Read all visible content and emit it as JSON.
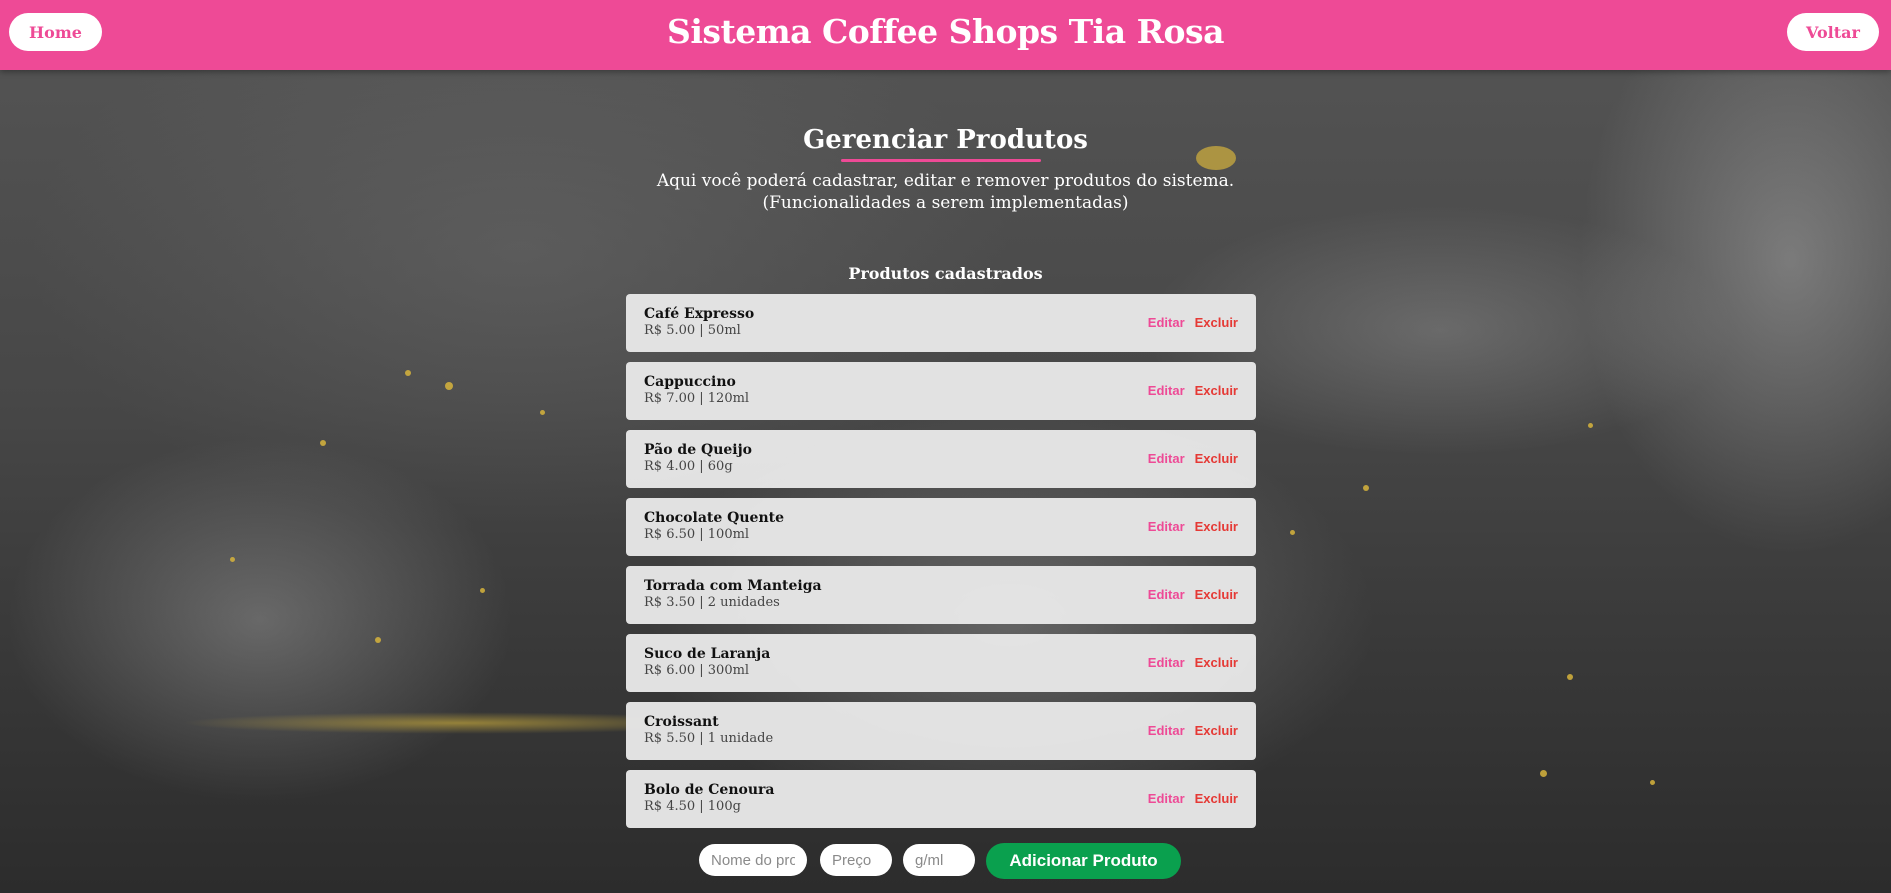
{
  "header": {
    "title": "Sistema Coffee Shops Tia Rosa",
    "home_label": "Home",
    "back_label": "Voltar"
  },
  "page": {
    "title": "Gerenciar Produtos",
    "description_line1": "Aqui você poderá cadastrar, editar e remover produtos do sistema.",
    "description_line2": "(Funcionalidades a serem implementadas)",
    "list_title": "Produtos cadastrados"
  },
  "products": [
    {
      "name": "Café Expresso",
      "meta": "R$ 5.00 | 50ml",
      "edit": "Editar",
      "delete": "Excluir"
    },
    {
      "name": "Cappuccino",
      "meta": "R$ 7.00 | 120ml",
      "edit": "Editar",
      "delete": "Excluir"
    },
    {
      "name": "Pão de Queijo",
      "meta": "R$ 4.00 | 60g",
      "edit": "Editar",
      "delete": "Excluir"
    },
    {
      "name": "Chocolate Quente",
      "meta": "R$ 6.50 | 100ml",
      "edit": "Editar",
      "delete": "Excluir"
    },
    {
      "name": "Torrada com Manteiga",
      "meta": "R$ 3.50 | 2 unidades",
      "edit": "Editar",
      "delete": "Excluir"
    },
    {
      "name": "Suco de Laranja",
      "meta": "R$ 6.00 | 300ml",
      "edit": "Editar",
      "delete": "Excluir"
    },
    {
      "name": "Croissant",
      "meta": "R$ 5.50 | 1 unidade",
      "edit": "Editar",
      "delete": "Excluir"
    },
    {
      "name": "Bolo de Cenoura",
      "meta": "R$ 4.50 | 100g",
      "edit": "Editar",
      "delete": "Excluir"
    }
  ],
  "form": {
    "name_placeholder": "Nome do produto",
    "price_placeholder": "Preço",
    "qty_placeholder": "g/ml",
    "add_label": "Adicionar Produto"
  },
  "colors": {
    "accent": "#ee4a96",
    "add_button": "#0aa04e",
    "delete": "#e53935"
  }
}
